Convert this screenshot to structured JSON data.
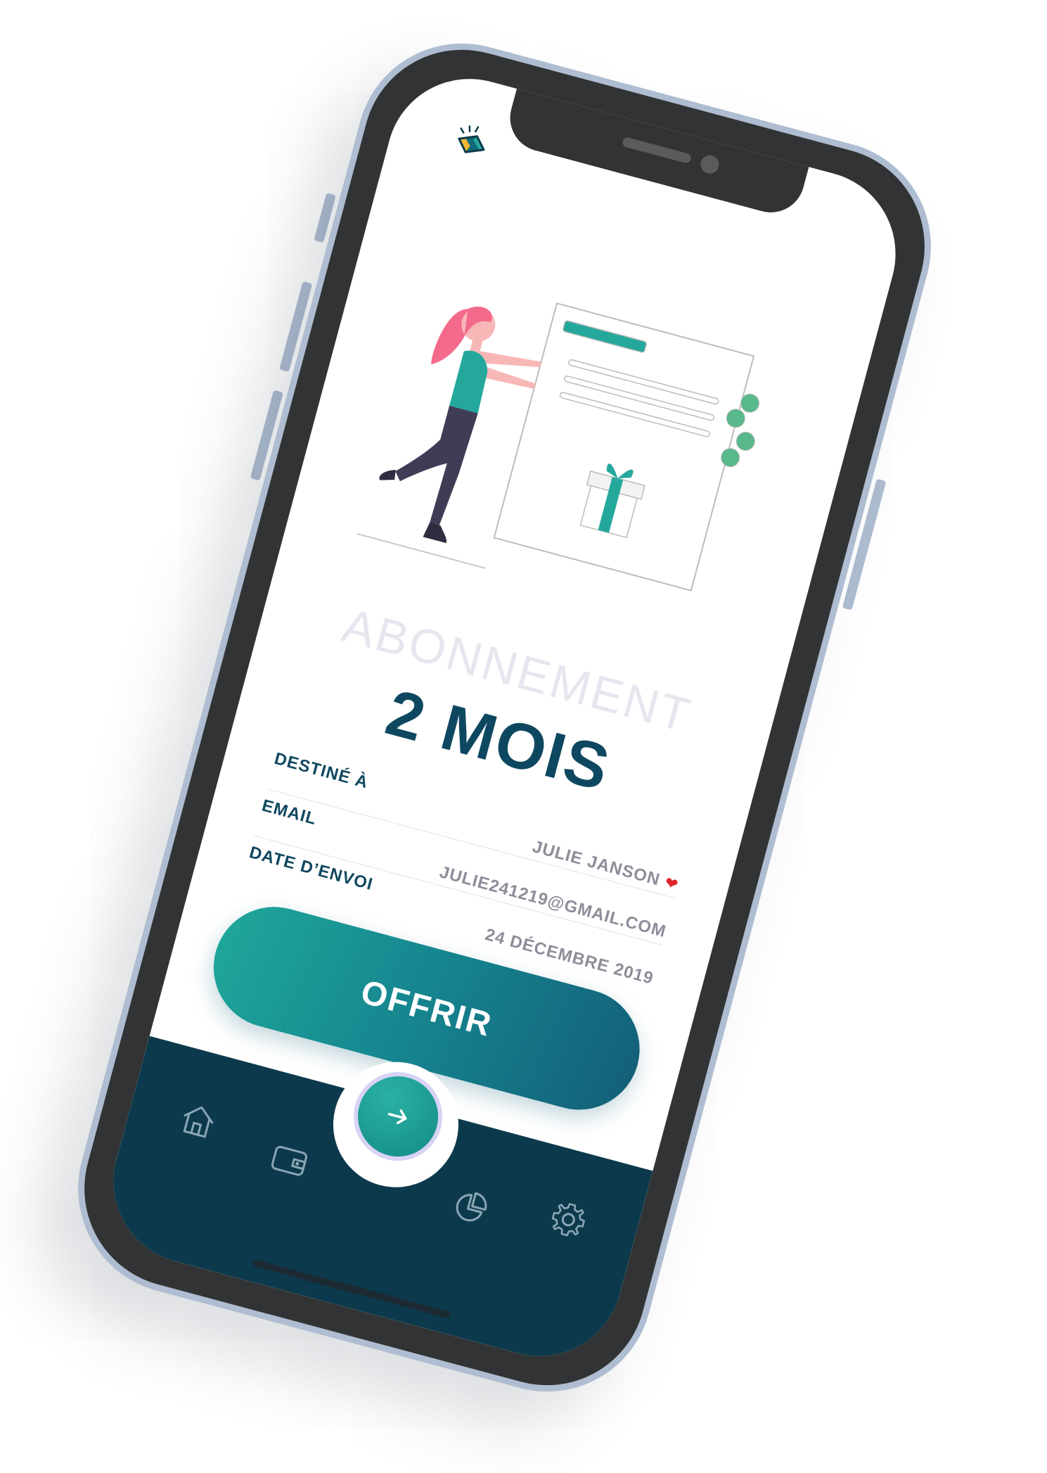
{
  "screen": {
    "subtitle": "ABONNEMENT",
    "plan": "2 MOIS"
  },
  "details": {
    "recipient_label": "DESTINÉ À",
    "recipient_value": "JULIE JANSON",
    "email_label": "EMAIL",
    "email_value": "JULIE241219@GMAIL.COM",
    "date_label": "DATE D’ENVOI",
    "date_value": "24 DÉCEMBRE 2019"
  },
  "actions": {
    "offer_label": "OFFRIR"
  },
  "tabbar": {
    "items": [
      "home-icon",
      "wallet-icon",
      "arrow-right-icon",
      "pie-chart-icon",
      "gear-icon"
    ]
  },
  "colors": {
    "primary_dark": "#0e4860",
    "accent_teal": "#1fa79a",
    "tabbar_bg": "#0c3a4c",
    "frame_outline": "#aebdd1"
  }
}
